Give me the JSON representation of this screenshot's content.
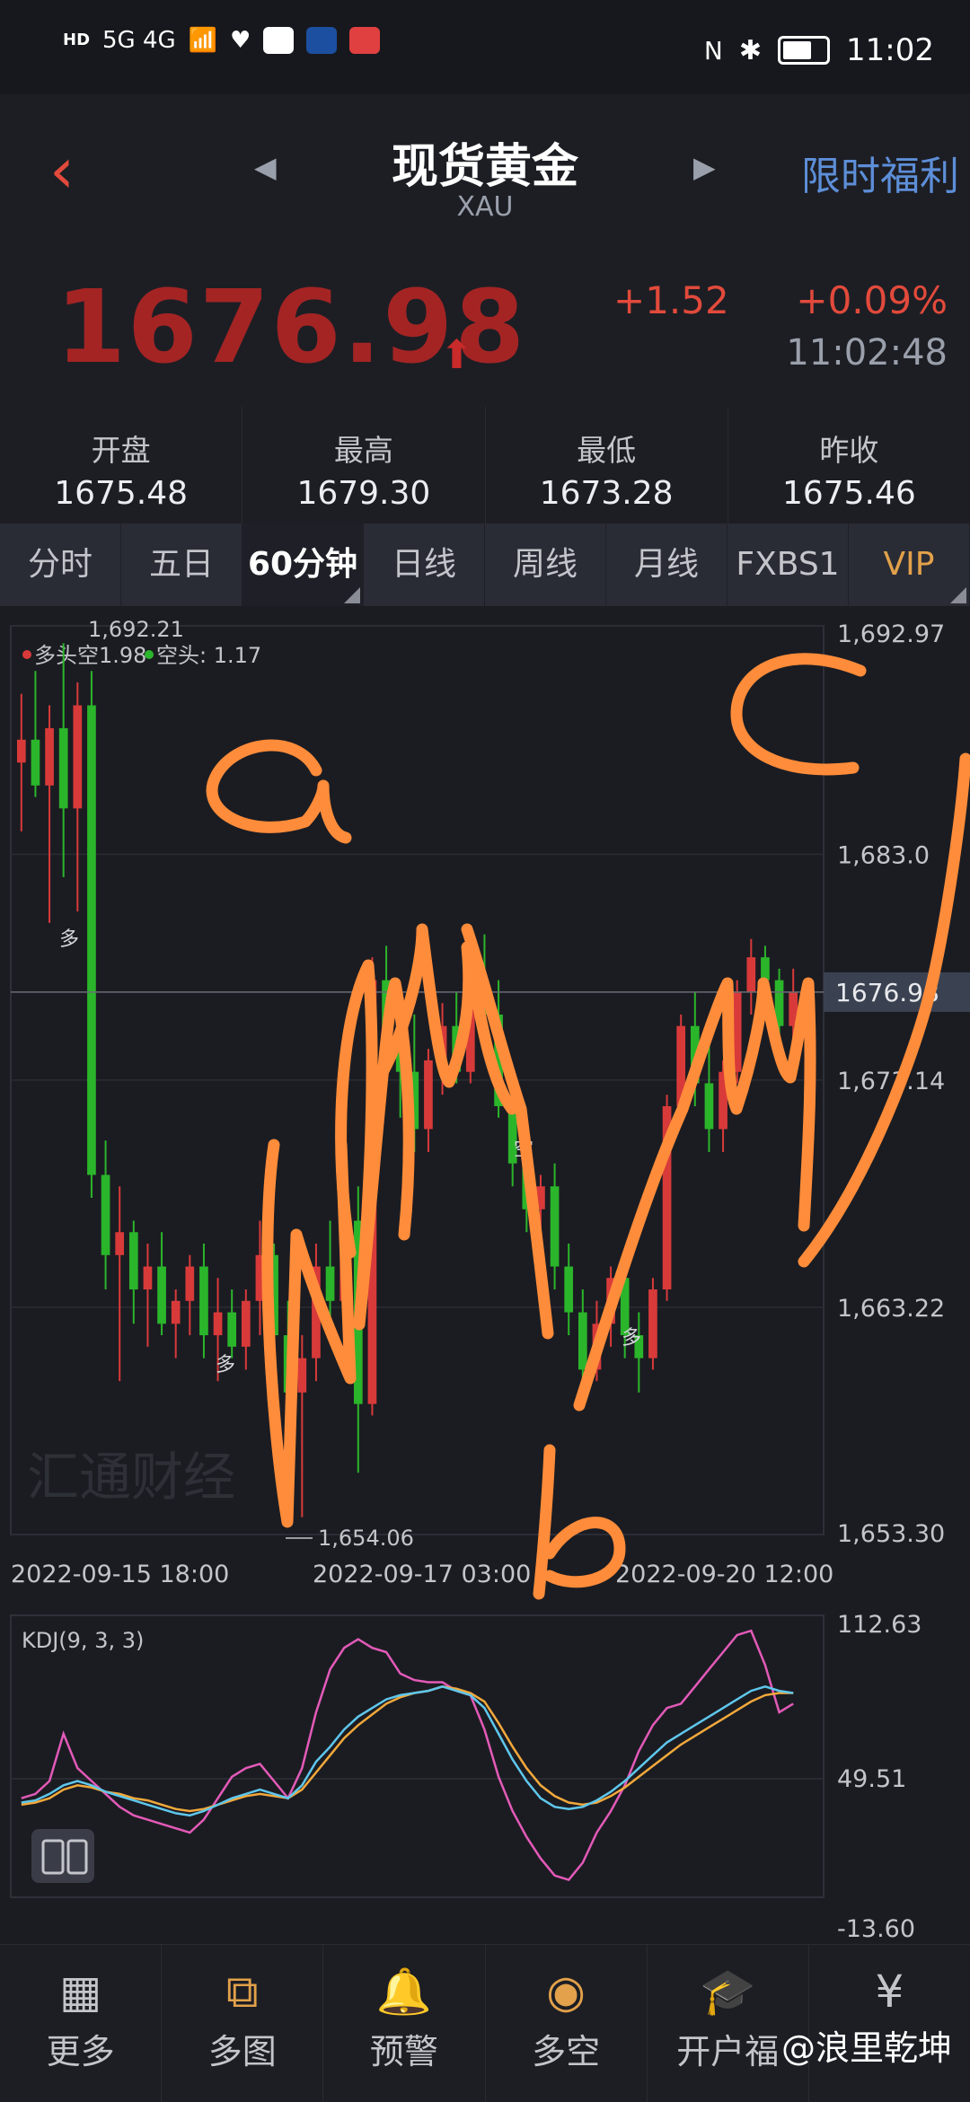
{
  "status": {
    "time": "11:02",
    "network": "5G 4G",
    "hd": "HD"
  },
  "header": {
    "title": "现货黄金",
    "subtitle": "XAU",
    "promo": "限时福利"
  },
  "quote": {
    "price": "1676.98",
    "change": "+1.52",
    "change_pct": "+0.09%",
    "time": "11:02:48"
  },
  "stats": [
    {
      "label": "开盘",
      "value": "1675.48"
    },
    {
      "label": "最高",
      "value": "1679.30"
    },
    {
      "label": "最低",
      "value": "1673.28"
    },
    {
      "label": "昨收",
      "value": "1675.46"
    }
  ],
  "tabs": [
    "分时",
    "五日",
    "60分钟",
    "日线",
    "周线",
    "月线",
    "FXBS1",
    "VIP"
  ],
  "active_tab": "60分钟",
  "main_chart": {
    "legend_long": "多头空1.98",
    "legend_short": "空头: 1.17",
    "y_ticks": [
      "1,692.97",
      "1,683.0",
      "1,673.14",
      "1,663.22",
      "1,653.30"
    ],
    "current_price": "1676.98",
    "high_label": "1,692.21",
    "low_label": "1,654.06",
    "x_labels": [
      "2022-09-15 18:00",
      "2022-09-17 03:00",
      "2022-09-20 12:00"
    ],
    "signals": [
      "多",
      "多",
      "空",
      "多"
    ],
    "watermark": "汇通财经",
    "annotations": [
      "a",
      "b",
      "c"
    ]
  },
  "chart_data": {
    "type": "candlestick",
    "title": "",
    "ylim": [
      1653.3,
      1692.97
    ],
    "candles": [
      {
        "o": 1687.0,
        "h": 1690.0,
        "l": 1684.0,
        "c": 1688.0
      },
      {
        "o": 1688.0,
        "h": 1691.0,
        "l": 1685.5,
        "c": 1686.0
      },
      {
        "o": 1686.0,
        "h": 1689.5,
        "l": 1680.0,
        "c": 1688.5
      },
      {
        "o": 1688.5,
        "h": 1692.21,
        "l": 1682.0,
        "c": 1685.0
      },
      {
        "o": 1685.0,
        "h": 1690.5,
        "l": 1680.5,
        "c": 1689.5
      },
      {
        "o": 1689.5,
        "h": 1691.0,
        "l": 1668.0,
        "c": 1669.0
      },
      {
        "o": 1669.0,
        "h": 1670.5,
        "l": 1664.0,
        "c": 1665.5
      },
      {
        "o": 1665.5,
        "h": 1668.5,
        "l": 1660.0,
        "c": 1666.5
      },
      {
        "o": 1666.5,
        "h": 1667.0,
        "l": 1662.5,
        "c": 1664.0
      },
      {
        "o": 1664.0,
        "h": 1666.0,
        "l": 1661.5,
        "c": 1665.0
      },
      {
        "o": 1665.0,
        "h": 1666.5,
        "l": 1662.0,
        "c": 1662.5
      },
      {
        "o": 1662.5,
        "h": 1664.0,
        "l": 1661.0,
        "c": 1663.5
      },
      {
        "o": 1663.5,
        "h": 1665.5,
        "l": 1662.0,
        "c": 1665.0
      },
      {
        "o": 1665.0,
        "h": 1666.0,
        "l": 1661.0,
        "c": 1662.0
      },
      {
        "o": 1662.0,
        "h": 1664.5,
        "l": 1660.0,
        "c": 1663.0
      },
      {
        "o": 1663.0,
        "h": 1664.0,
        "l": 1661.0,
        "c": 1661.5
      },
      {
        "o": 1661.5,
        "h": 1664.0,
        "l": 1660.5,
        "c": 1663.5
      },
      {
        "o": 1663.5,
        "h": 1667.0,
        "l": 1662.0,
        "c": 1665.5
      },
      {
        "o": 1665.5,
        "h": 1666.0,
        "l": 1661.0,
        "c": 1662.0
      },
      {
        "o": 1662.0,
        "h": 1663.5,
        "l": 1658.5,
        "c": 1659.5
      },
      {
        "o": 1659.5,
        "h": 1662.0,
        "l": 1654.06,
        "c": 1661.0
      },
      {
        "o": 1661.0,
        "h": 1666.0,
        "l": 1660.0,
        "c": 1665.0
      },
      {
        "o": 1665.0,
        "h": 1667.0,
        "l": 1662.5,
        "c": 1663.5
      },
      {
        "o": 1663.5,
        "h": 1668.0,
        "l": 1662.0,
        "c": 1667.0
      },
      {
        "o": 1667.0,
        "h": 1668.5,
        "l": 1656.0,
        "c": 1659.0
      },
      {
        "o": 1659.0,
        "h": 1678.5,
        "l": 1658.5,
        "c": 1677.5
      },
      {
        "o": 1677.5,
        "h": 1679.0,
        "l": 1673.0,
        "c": 1675.0
      },
      {
        "o": 1675.0,
        "h": 1677.0,
        "l": 1671.5,
        "c": 1673.5
      },
      {
        "o": 1673.5,
        "h": 1676.0,
        "l": 1670.0,
        "c": 1671.0
      },
      {
        "o": 1671.0,
        "h": 1674.5,
        "l": 1670.0,
        "c": 1674.0
      },
      {
        "o": 1674.0,
        "h": 1676.5,
        "l": 1672.5,
        "c": 1675.5
      },
      {
        "o": 1675.5,
        "h": 1677.0,
        "l": 1673.0,
        "c": 1673.5
      },
      {
        "o": 1673.5,
        "h": 1678.5,
        "l": 1673.0,
        "c": 1677.5
      },
      {
        "o": 1677.5,
        "h": 1679.5,
        "l": 1675.0,
        "c": 1676.0
      },
      {
        "o": 1676.0,
        "h": 1677.5,
        "l": 1671.5,
        "c": 1672.0
      },
      {
        "o": 1672.0,
        "h": 1673.0,
        "l": 1668.5,
        "c": 1669.5
      },
      {
        "o": 1669.5,
        "h": 1671.0,
        "l": 1666.5,
        "c": 1667.5
      },
      {
        "o": 1667.5,
        "h": 1669.0,
        "l": 1666.0,
        "c": 1668.5
      },
      {
        "o": 1668.5,
        "h": 1669.5,
        "l": 1664.0,
        "c": 1665.0
      },
      {
        "o": 1665.0,
        "h": 1666.0,
        "l": 1662.0,
        "c": 1663.0
      },
      {
        "o": 1663.0,
        "h": 1664.0,
        "l": 1659.5,
        "c": 1660.5
      },
      {
        "o": 1660.5,
        "h": 1663.5,
        "l": 1660.0,
        "c": 1662.5
      },
      {
        "o": 1662.5,
        "h": 1665.0,
        "l": 1661.5,
        "c": 1664.5
      },
      {
        "o": 1664.5,
        "h": 1665.5,
        "l": 1661.0,
        "c": 1662.0
      },
      {
        "o": 1662.0,
        "h": 1663.0,
        "l": 1659.5,
        "c": 1661.0
      },
      {
        "o": 1661.0,
        "h": 1664.5,
        "l": 1660.5,
        "c": 1664.0
      },
      {
        "o": 1664.0,
        "h": 1672.5,
        "l": 1663.5,
        "c": 1672.0
      },
      {
        "o": 1672.0,
        "h": 1676.0,
        "l": 1671.5,
        "c": 1675.5
      },
      {
        "o": 1675.5,
        "h": 1677.0,
        "l": 1672.0,
        "c": 1673.0
      },
      {
        "o": 1673.0,
        "h": 1675.0,
        "l": 1670.0,
        "c": 1671.0
      },
      {
        "o": 1671.0,
        "h": 1674.0,
        "l": 1670.0,
        "c": 1673.5
      },
      {
        "o": 1673.5,
        "h": 1677.5,
        "l": 1673.0,
        "c": 1677.0
      },
      {
        "o": 1677.0,
        "h": 1679.3,
        "l": 1676.0,
        "c": 1678.5
      },
      {
        "o": 1678.5,
        "h": 1679.0,
        "l": 1676.5,
        "c": 1677.5
      },
      {
        "o": 1677.5,
        "h": 1678.0,
        "l": 1674.5,
        "c": 1675.5
      },
      {
        "o": 1675.5,
        "h": 1678.0,
        "l": 1675.0,
        "c": 1676.98
      }
    ]
  },
  "kdj": {
    "title": "KDJ(9, 3, 3)",
    "y_ticks": [
      "112.63",
      "49.51",
      "-13.60"
    ],
    "ylim": [
      -13.6,
      112.63
    ],
    "K": [
      28,
      29,
      32,
      36,
      38,
      36,
      33,
      31,
      29,
      27,
      25,
      23,
      22,
      24,
      27,
      30,
      32,
      34,
      32,
      30,
      36,
      47,
      54,
      62,
      68,
      72,
      76,
      78,
      79,
      80,
      82,
      80,
      78,
      72,
      60,
      48,
      38,
      30,
      26,
      25,
      26,
      29,
      33,
      38,
      44,
      50,
      56,
      60,
      64,
      68,
      72,
      76,
      80,
      82,
      80,
      79
    ],
    "D": [
      27,
      28,
      30,
      34,
      36,
      35,
      33,
      32,
      30,
      29,
      27,
      25,
      24,
      25,
      27,
      29,
      31,
      32,
      31,
      30,
      34,
      42,
      50,
      58,
      64,
      69,
      74,
      77,
      79,
      80,
      82,
      81,
      79,
      75,
      65,
      54,
      44,
      36,
      31,
      28,
      27,
      28,
      31,
      35,
      40,
      45,
      50,
      55,
      59,
      63,
      67,
      71,
      75,
      78,
      79,
      79
    ],
    "J": [
      30,
      32,
      38,
      60,
      44,
      38,
      32,
      26,
      22,
      20,
      18,
      16,
      14,
      20,
      30,
      40,
      44,
      46,
      38,
      30,
      44,
      70,
      90,
      100,
      104,
      100,
      98,
      88,
      85,
      84,
      84,
      80,
      78,
      62,
      40,
      24,
      12,
      2,
      -6,
      -8,
      0,
      14,
      24,
      36,
      52,
      64,
      72,
      74,
      82,
      90,
      98,
      106,
      108,
      92,
      70,
      74
    ]
  },
  "bottom_nav": [
    {
      "label": "更多",
      "icon": "grid-icon"
    },
    {
      "label": "多图",
      "icon": "multi-chart-icon"
    },
    {
      "label": "预警",
      "icon": "bell-icon"
    },
    {
      "label": "多空",
      "icon": "trend-icon"
    },
    {
      "label": "开户福",
      "icon": "gift-icon"
    },
    {
      "label": "",
      "icon": "money-bag-icon"
    }
  ],
  "watermark_user": "@浪里乾坤",
  "colors": {
    "up": "#d83a3a",
    "down": "#2bb52b",
    "annotation": "#ff8c3a",
    "k": "#5fc7ec",
    "d": "#f2a93b",
    "j": "#e35ab8"
  }
}
